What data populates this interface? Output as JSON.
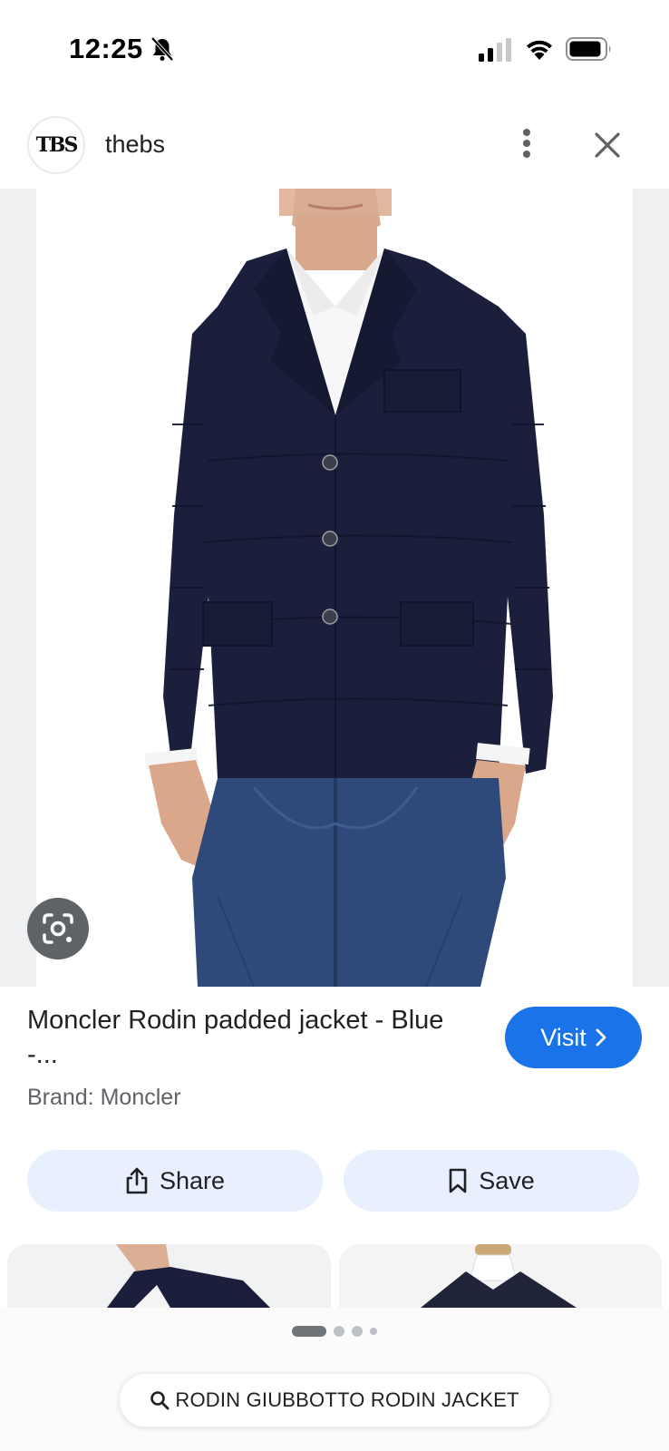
{
  "status_bar": {
    "time": "12:25",
    "icons": [
      "bell-slash-icon",
      "signal-icon",
      "wifi-icon",
      "battery-icon"
    ]
  },
  "source": {
    "name": "thebs",
    "avatar_text": "TBS",
    "icons": [
      "more-vert-icon",
      "close-icon"
    ]
  },
  "image": {
    "lens_icon": "google-lens-icon"
  },
  "product": {
    "title": "Moncler Rodin padded jacket - Blue -...",
    "brand": "Brand: Moncler"
  },
  "actions": {
    "visit_label": "Visit",
    "share_label": "Share",
    "save_label": "Save"
  },
  "carousel": {
    "total_dots": 4,
    "active_index": 0
  },
  "query": {
    "text": "RODIN GIUBBOTTO RODIN JACKET"
  },
  "colors": {
    "accent_blue": "#1a73e8",
    "pill_bg": "#e8f0fe",
    "jacket_navy": "#1b1f3b",
    "jeans_blue": "#2f4a7a"
  }
}
